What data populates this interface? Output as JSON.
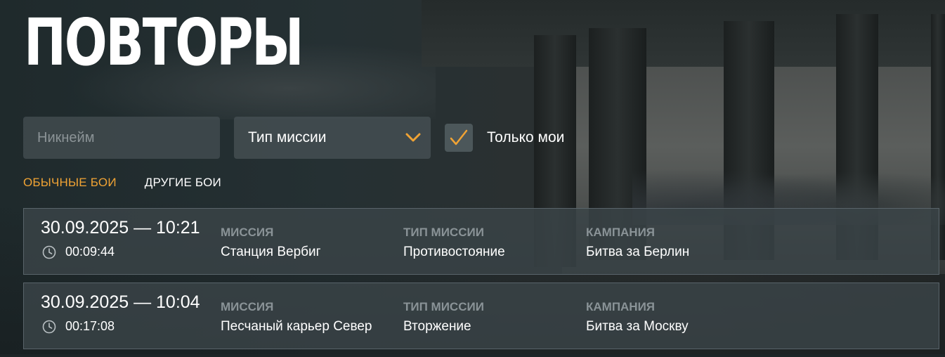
{
  "page": {
    "title": "ПОВТОРЫ"
  },
  "filters": {
    "nickname_placeholder": "Никнейм",
    "nickname_value": "",
    "mission_type_selected": "Тип миссии",
    "only_mine_label": "Только мои",
    "only_mine_checked": true
  },
  "tabs": [
    {
      "label": "ОБЫЧНЫЕ БОИ",
      "active": true
    },
    {
      "label": "ДРУГИЕ БОИ",
      "active": false
    }
  ],
  "labels": {
    "mission": "МИССИЯ",
    "mission_type": "ТИП МИССИИ",
    "campaign": "КАМПАНИЯ"
  },
  "replays": [
    {
      "datetime": "30.09.2025 — 10:21",
      "duration": "00:09:44",
      "mission": "Станция Вербиг",
      "mission_type": "Противостояние",
      "campaign": "Битва за Берлин"
    },
    {
      "datetime": "30.09.2025 — 10:04",
      "duration": "00:17:08",
      "mission": "Песчаный карьер Север",
      "mission_type": "Вторжение",
      "campaign": "Битва за Москву"
    }
  ],
  "colors": {
    "accent": "#f0a334",
    "muted_label": "#8a9397",
    "row_bg": "#3a4448"
  },
  "icons": {
    "select_chevron": "chevron-down-icon",
    "checkbox": "checkmark-icon",
    "duration": "clock-icon"
  }
}
